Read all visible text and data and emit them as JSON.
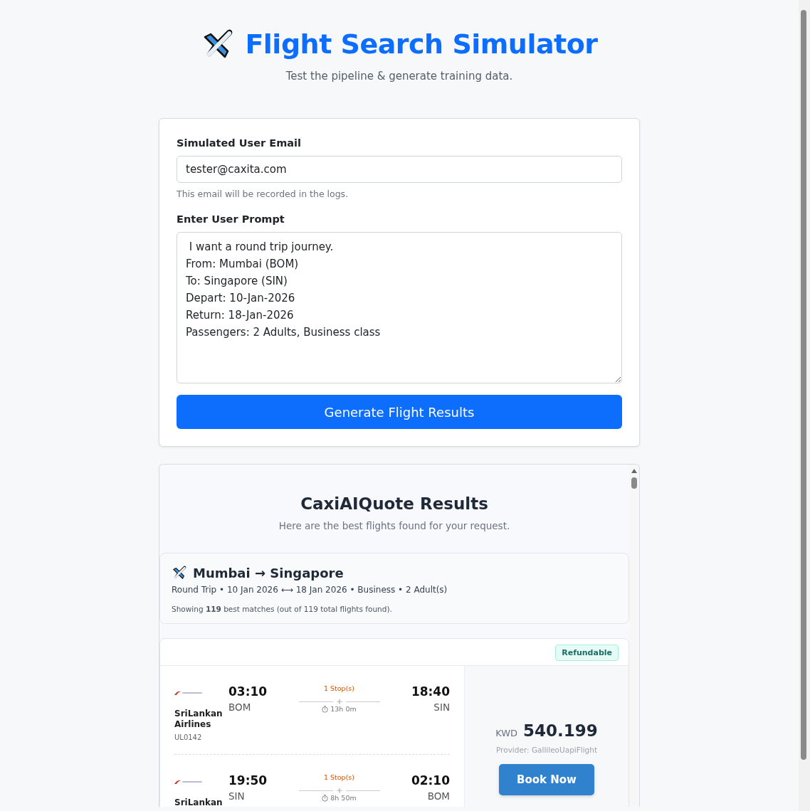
{
  "header": {
    "title": "Flight Search Simulator",
    "subtitle": "Test the pipeline & generate training data."
  },
  "form": {
    "email_label": "Simulated User Email",
    "email_value": "tester@caxita.com",
    "email_help": "This email will be recorded in the logs.",
    "prompt_label": "Enter User Prompt",
    "prompt_value": " I want a round trip journey.\nFrom: Mumbai (BOM)\nTo: Singapore (SIN)\nDepart: 10-Jan-2026\nReturn: 18-Jan-2026\nPassengers: 2 Adults, Business class",
    "submit": "Generate Flight Results"
  },
  "results": {
    "title": "CaxiAIQuote Results",
    "subtitle": "Here are the best flights found for your request.",
    "summary": {
      "route": "Mumbai → Singapore",
      "details": "Round Trip • 10 Jan 2026 ⟷ 18 Jan 2026 • Business • 2 Adult(s)",
      "showing": "Showing **119** best matches (out of 119 total flights found)."
    },
    "offers": [
      {
        "badge": "Refundable",
        "currency": "KWD",
        "price": "540.199",
        "provider": "Provider: GallileoUapiFlight",
        "book": "Book Now",
        "legs": [
          {
            "airline": "SriLankan Airlines",
            "flight_no": "UL0142",
            "dep_time": "03:10",
            "dep_code": "BOM",
            "stops": "1 Stop(s)",
            "duration": "13h 0m",
            "arr_time": "18:40",
            "arr_code": "SIN"
          },
          {
            "airline": "SriLankan",
            "dep_time": "19:50",
            "dep_code": "SIN",
            "stops": "1 Stop(s)",
            "duration": "8h 50m",
            "arr_time": "02:10",
            "arr_code": "BOM"
          }
        ]
      }
    ]
  }
}
